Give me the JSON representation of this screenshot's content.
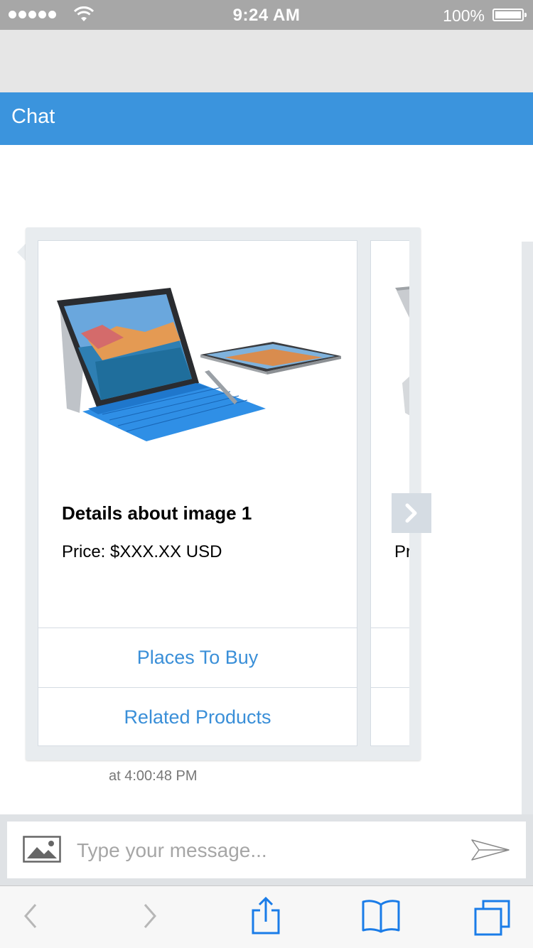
{
  "status_bar": {
    "time": "9:24 AM",
    "battery_percent": "100%",
    "signal_dots": 5
  },
  "chat": {
    "title": "Chat"
  },
  "message": {
    "timestamp": "at 4:00:48 PM",
    "cards": [
      {
        "image_subject": "surface-tablet-with-blue-keyboard",
        "title": "Details about image 1",
        "price": "Price: $XXX.XX USD",
        "buttons": [
          "Places To Buy",
          "Related Products"
        ]
      },
      {
        "price_partial": "Pr"
      }
    ],
    "next_icon": "chevron-right-icon"
  },
  "composer": {
    "placeholder": "Type your message...",
    "attach_icon": "image-icon",
    "send_icon": "send-icon"
  },
  "toolbar": {
    "items": [
      "back-icon",
      "forward-icon",
      "share-icon",
      "bookmarks-icon",
      "tabs-icon"
    ]
  },
  "colors": {
    "header": "#3b94dd",
    "link": "#3a8fd8",
    "status_bar": "#a7a7a7",
    "toolbar_icon": "#1a7ce8"
  }
}
